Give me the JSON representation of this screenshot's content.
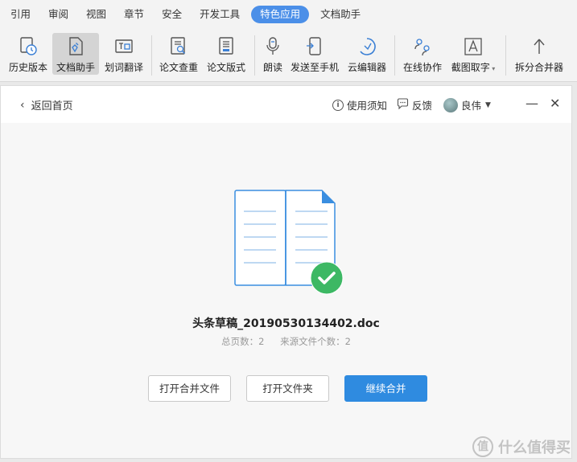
{
  "menubar": {
    "items": [
      {
        "label": "引用"
      },
      {
        "label": "审阅"
      },
      {
        "label": "视图"
      },
      {
        "label": "章节"
      },
      {
        "label": "安全"
      },
      {
        "label": "开发工具"
      },
      {
        "label": "特色应用"
      },
      {
        "label": "文档助手"
      }
    ],
    "active_index": 6,
    "active_color": "#4b8fe8"
  },
  "ribbon": {
    "buttons": [
      {
        "label": "历史版本",
        "icon": "history-clock-icon"
      },
      {
        "label": "文档助手",
        "icon": "doc-assistant-icon"
      },
      {
        "label": "划词翻译",
        "icon": "translate-icon"
      },
      {
        "label": "论文查重",
        "icon": "paper-check-icon"
      },
      {
        "label": "论文版式",
        "icon": "paper-format-icon"
      },
      {
        "label": "朗读",
        "icon": "microphone-icon"
      },
      {
        "label": "发送至手机",
        "icon": "phone-icon"
      },
      {
        "label": "云编辑器",
        "icon": "cloud-editor-icon"
      },
      {
        "label": "在线协作",
        "icon": "collaboration-icon"
      },
      {
        "label": "截图取字",
        "icon": "screenshot-ocr-icon"
      },
      {
        "label": "拆分合并器",
        "icon": "split-merge-icon"
      }
    ],
    "active_label": "文档助手"
  },
  "dialog": {
    "back_label": "返回首页",
    "help_label": "使用须知",
    "feedback_label": "反馈",
    "user_name": "良伟",
    "minimize_glyph": "—",
    "close_glyph": "✕"
  },
  "result": {
    "file_name": "头条草稿_20190530134402.doc",
    "total_pages_text": "总页数：2",
    "source_files_text": "来源文件个数：2",
    "success_color": "#3db864"
  },
  "actions": {
    "open_merged_label": "打开合并文件",
    "open_folder_label": "打开文件夹",
    "continue_merge_label": "继续合并",
    "primary_color": "#2f8be0"
  },
  "watermark": {
    "badge": "值",
    "text": "什么值得买"
  }
}
